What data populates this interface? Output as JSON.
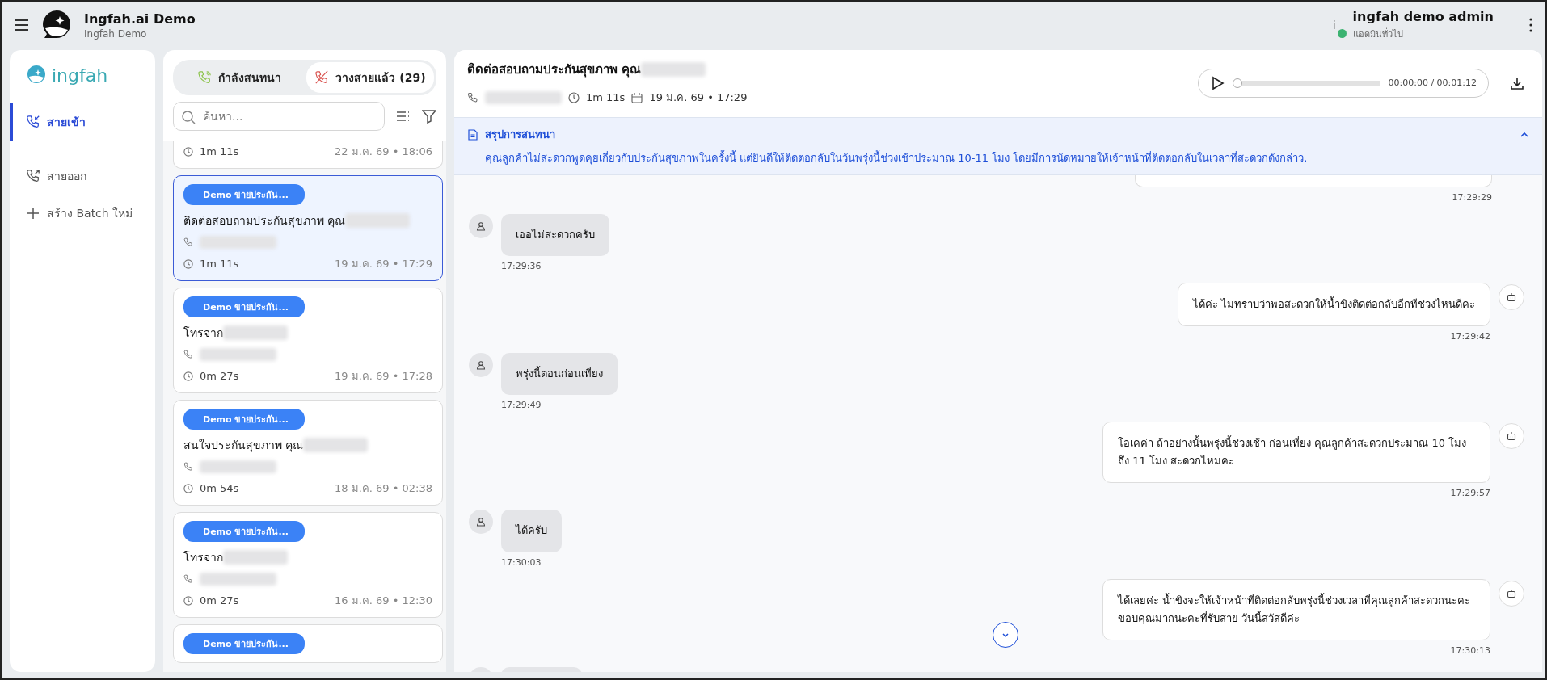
{
  "app": {
    "title": "Ingfah.ai Demo",
    "subtitle": "Ingfah Demo"
  },
  "user": {
    "info_mark": "i",
    "name": "ingfah demo admin",
    "role": "แอดมินทั่วไป",
    "status": {
      "color": "#3cb371"
    }
  },
  "sidebar": {
    "brand": "ingfah",
    "items": [
      {
        "kind": "incoming",
        "label": "สายเข้า",
        "selected": true
      },
      {
        "kind": "outgoing",
        "label": "สายออก",
        "selected": false
      },
      {
        "kind": "create",
        "label": "สร้าง Batch ใหม่",
        "selected": false
      }
    ]
  },
  "call_tabs": [
    {
      "kind": "active",
      "label": "กำลังสนทนา",
      "selected": false
    },
    {
      "kind": "ended",
      "label": "วางสายแล้ว (29)",
      "selected": true
    }
  ],
  "search": {
    "placeholder": "ค้นหา..."
  },
  "calls": [
    {
      "duration": "1m 11s",
      "date": "22 ม.ค. 69 • 18:06",
      "selected": false
    },
    {
      "badge": "Demo ขายประกัน...",
      "title": "ติดต่อสอบถามประกันสุขภาพ คุณ",
      "duration": "1m 11s",
      "date": "19 ม.ค. 69 • 17:29",
      "selected": true
    },
    {
      "badge": "Demo ขายประกัน...",
      "title": "โทรจาก",
      "duration": "0m 27s",
      "date": "19 ม.ค. 69 • 17:28",
      "selected": false
    },
    {
      "badge": "Demo ขายประกัน...",
      "title": "สนใจประกันสุขภาพ คุณ",
      "duration": "0m 54s",
      "date": "18 ม.ค. 69 • 02:38",
      "selected": false
    },
    {
      "badge": "Demo ขายประกัน...",
      "title": "โทรจาก",
      "duration": "0m 27s",
      "date": "16 ม.ค. 69 • 12:30",
      "selected": false
    },
    {
      "badge": "Demo ขายประกัน...",
      "selected": false
    }
  ],
  "detail": {
    "title": "ติดต่อสอบถามประกันสุขภาพ คุณ",
    "duration": "1m 11s",
    "date": "19 ม.ค. 69 • 17:29",
    "player": {
      "time": "00:00:00 / 00:01:12",
      "level": 0
    }
  },
  "summary": {
    "title": "สรุปการสนทนา",
    "text": "คุณลูกค้าไม่สะดวกพูดคุยเกี่ยวกับประกันสุขภาพในครั้งนี้ แต่ยินดีให้ติดต่อกลับในวันพรุ่งนี้ช่วงเช้าประมาณ 10-11 โมง โดยมีการนัดหมายให้เจ้าหน้าที่ติดต่อกลับในเวลาที่สะดวกดังกล่าว."
  },
  "messages": [
    {
      "kind": "bot",
      "time": "17:29:29"
    },
    {
      "kind": "user",
      "text": "เออไม่สะดวกครับ",
      "time": "17:29:36"
    },
    {
      "kind": "bot",
      "text": "ได้ค่ะ ไม่ทราบว่าพอสะดวกให้น้ำขิงติดต่อกลับอีกทีช่วงไหนดีคะ",
      "time": "17:29:42"
    },
    {
      "kind": "user",
      "text": "พรุ่งนี้ตอนก่อนเที่ยง",
      "time": "17:29:49"
    },
    {
      "kind": "bot",
      "text": "โอเคค่า ถ้าอย่างนั้นพรุ่งนี้ช่วงเช้า ก่อนเที่ยง คุณลูกค้าสะดวกประมาณ 10 โมง ถึง 11 โมง สะดวกไหมคะ",
      "time": "17:29:57"
    },
    {
      "kind": "user",
      "text": "ได้ครับ",
      "time": "17:30:03"
    },
    {
      "kind": "bot",
      "text": "ได้เลยค่ะ น้ำขิงจะให้เจ้าหน้าที่ติดต่อกลับพรุ่งนี้ช่วงเวลาที่คุณลูกค้าสะดวกนะคะ ขอบคุณมากนะคะที่รับสาย วันนี้สวัสดีค่ะ",
      "time": "17:30:13"
    },
    {
      "kind": "user"
    }
  ]
}
